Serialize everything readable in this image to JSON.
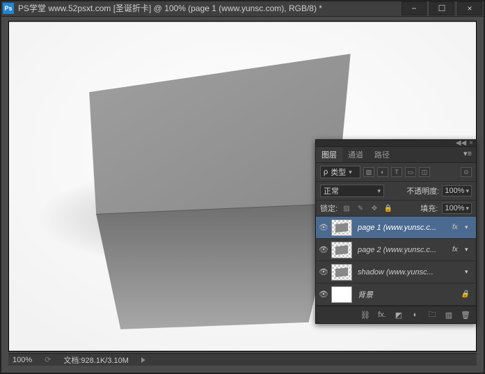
{
  "titlebar": {
    "app_icon_text": "Ps",
    "title": "PS学堂 www.52psxt.com [圣诞折卡] @ 100% (page 1 (www.yunsc.com), RGB/8) *"
  },
  "statusbar": {
    "zoom": "100%",
    "doc_label": "文档:928.1K/3.10M"
  },
  "panel": {
    "tabs": {
      "layers": "图层",
      "channels": "通道",
      "paths": "路径"
    },
    "filter_label": "类型",
    "filter_selected": "ρ",
    "blend_mode": "正常",
    "opacity_label": "不透明度:",
    "opacity_value": "100%",
    "lock_label": "锁定:",
    "fill_label": "填充:",
    "fill_value": "100%",
    "layers": [
      {
        "name": "page 1 (www.yunsc.c...",
        "selected": true,
        "fx": true,
        "alpha": true,
        "card": true
      },
      {
        "name": "page 2 (www.yunsc.c...",
        "selected": false,
        "fx": true,
        "alpha": true,
        "card": true
      },
      {
        "name": "shadow (www.yunsc...",
        "selected": false,
        "fx": false,
        "alpha": true,
        "card": true
      },
      {
        "name": "背景",
        "selected": false,
        "fx": false,
        "alpha": false,
        "card": false,
        "bg": true
      }
    ],
    "fx_text": "fx",
    "footer_fx": "fx."
  }
}
